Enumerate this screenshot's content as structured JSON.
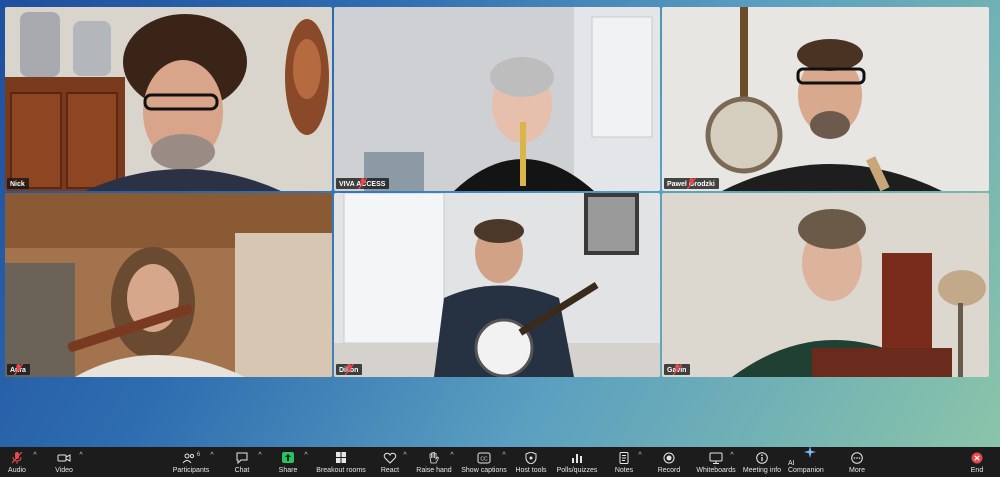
{
  "participants": [
    {
      "name": "Nick",
      "muted": false,
      "active": true
    },
    {
      "name": "VIVA ACCESS",
      "muted": true,
      "active": false
    },
    {
      "name": "Pawel Grodzki",
      "muted": true,
      "active": false
    },
    {
      "name": "Aura",
      "muted": true,
      "active": false
    },
    {
      "name": "Dillon",
      "muted": true,
      "active": false
    },
    {
      "name": "Gavin",
      "muted": true,
      "active": false
    }
  ],
  "toolbar": {
    "audio": "Audio",
    "video": "Video",
    "participants": "Participants",
    "participants_count": "6",
    "chat": "Chat",
    "share": "Share",
    "breakout": "Breakout rooms",
    "react": "React",
    "raise_hand": "Raise hand",
    "captions": "Show captions",
    "host_tools": "Host tools",
    "polls": "Polls/quizzes",
    "notes": "Notes",
    "record": "Record",
    "whiteboards": "Whiteboards",
    "meeting_info": "Meeting info",
    "ai_companion": "AI Companion",
    "more": "More",
    "end": "End"
  },
  "colors": {
    "active_speaker": "#22c55e",
    "share_green": "#22c55e",
    "mute_red": "#e5484d",
    "toolbar_bg": "#1c1c1c"
  }
}
